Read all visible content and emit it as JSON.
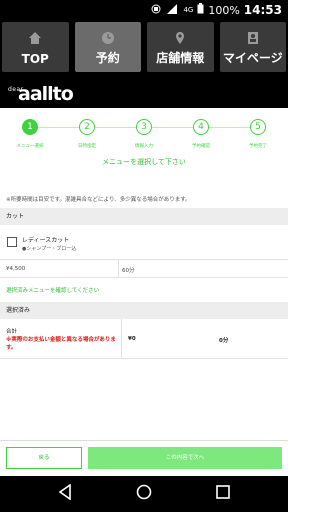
{
  "status_bar": {
    "signal": "4G",
    "battery": "100%",
    "time": "14:53"
  },
  "top_nav": [
    {
      "label": "TOP",
      "icon": "home-icon"
    },
    {
      "label": "予約",
      "icon": "clock-icon"
    },
    {
      "label": "店舗情報",
      "icon": "map-pin-icon"
    },
    {
      "label": "マイページ",
      "icon": "person-card-icon"
    }
  ],
  "logo": {
    "small": "dear",
    "big": "aallto"
  },
  "steps": [
    {
      "num": "1",
      "label": "メニュー選択"
    },
    {
      "num": "2",
      "label": "日時指定"
    },
    {
      "num": "3",
      "label": "情報入力"
    },
    {
      "num": "4",
      "label": "予約確認"
    },
    {
      "num": "5",
      "label": "予約完了"
    }
  ],
  "instruction": "メニューを選択して下さい",
  "note": "※所要時間は目安です。混雑具合などにより、多少異なる場合があります。",
  "cut_section": {
    "header": "カット",
    "item_name": "レディースカット",
    "item_sub": "●シャンプー・ブロー込",
    "price": "¥4,500",
    "duration": "60分"
  },
  "confirm_link": "選択済みメニューを確認してください",
  "selected_section": {
    "header": "選択済み",
    "total_label": "合計",
    "warning": "※実際のお支払い金額と異なる場合があります。",
    "total_price": "¥0",
    "total_duration": "0分"
  },
  "footer": {
    "back_label": "戻る",
    "next_label": "この内容で次へ"
  },
  "colors": {
    "accent_green": "#3fd23f",
    "warning_red": "#e21a1a"
  }
}
